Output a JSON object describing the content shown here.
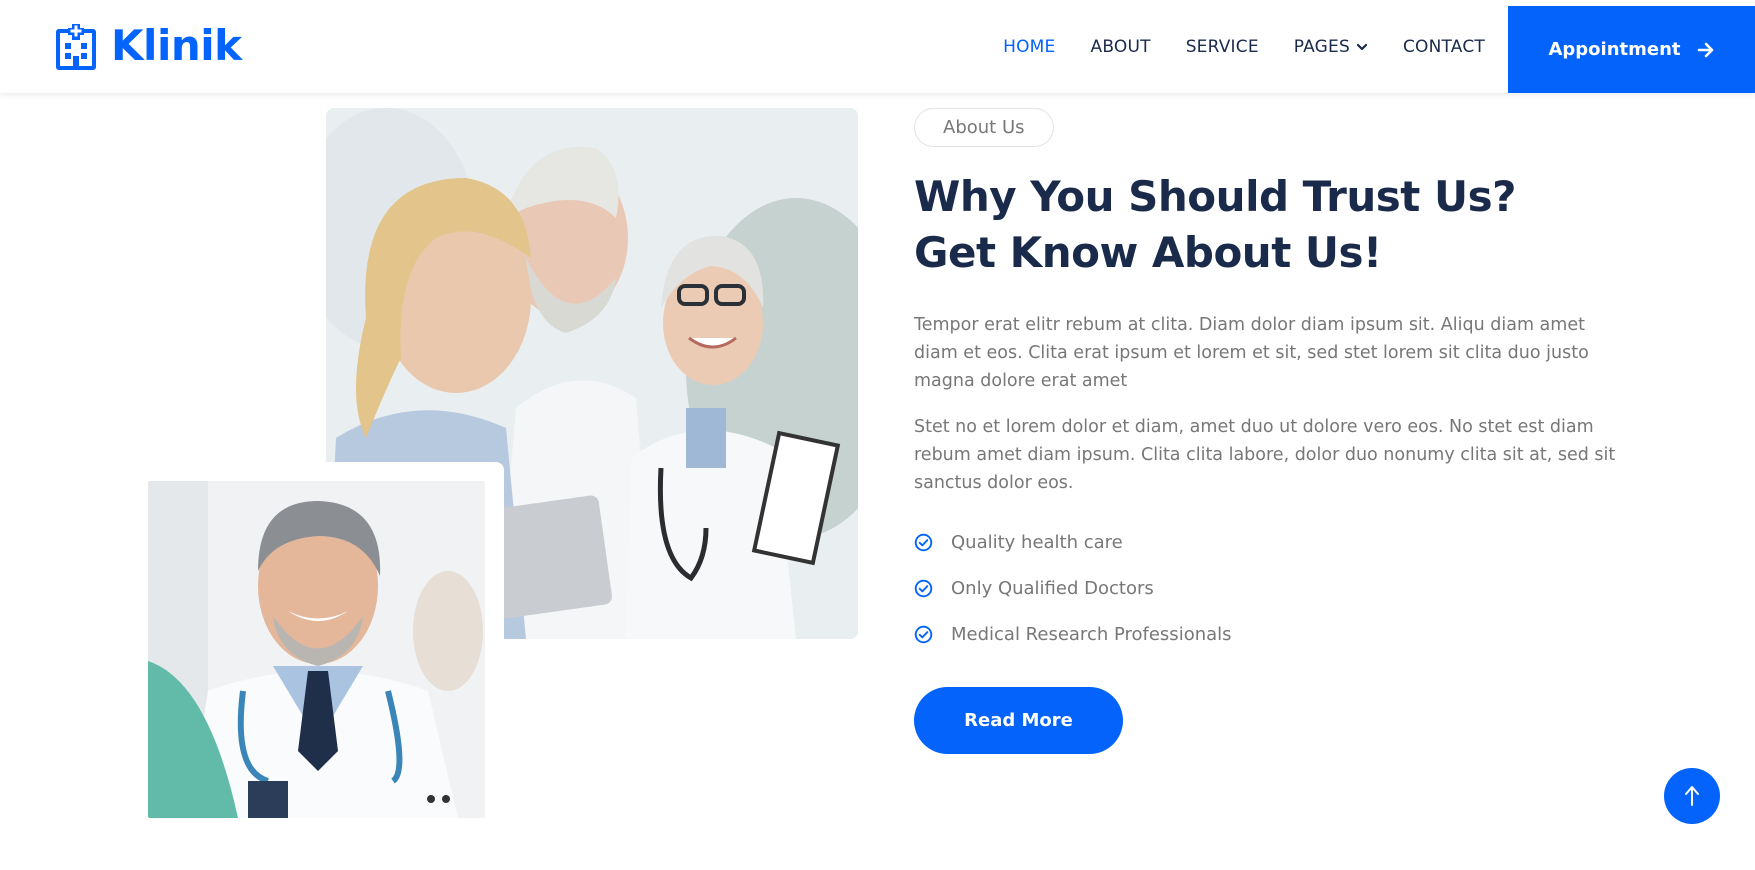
{
  "brand": {
    "name": "Klinik",
    "icon": "hospital-icon"
  },
  "nav": {
    "items": [
      {
        "label": "HOME",
        "active": true
      },
      {
        "label": "ABOUT",
        "active": false
      },
      {
        "label": "SERVICE",
        "active": false
      },
      {
        "label": "PAGES",
        "active": false,
        "dropdown": true
      },
      {
        "label": "CONTACT",
        "active": false
      }
    ],
    "cta_label": "Appointment",
    "cta_icon": "arrow-right-icon"
  },
  "about": {
    "tag": "About Us",
    "title": "Why You Should Trust Us? Get Know About Us!",
    "paragraphs": [
      "Tempor erat elitr rebum at clita. Diam dolor diam ipsum sit. Aliqu diam amet diam et eos. Clita erat ipsum et lorem et sit, sed stet lorem sit clita duo justo magna dolore erat amet",
      "Stet no et lorem dolor et diam, amet duo ut dolore vero eos. No stet est diam rebum amet diam ipsum. Clita clita labore, dolor duo nonumy clita sit at, sed sit sanctus dolor eos."
    ],
    "features": [
      "Quality health care",
      "Only Qualified Doctors",
      "Medical Research Professionals"
    ],
    "feature_icon": "check-circle-icon",
    "button_label": "Read More"
  },
  "images": {
    "main": "doctors-team-photo",
    "secondary": "smiling-doctor-photo"
  },
  "back_to_top_icon": "arrow-up-icon",
  "colors": {
    "primary": "#0463fa",
    "heading": "#1a2a4a",
    "body_text": "#777777",
    "background": "#ffffff"
  }
}
